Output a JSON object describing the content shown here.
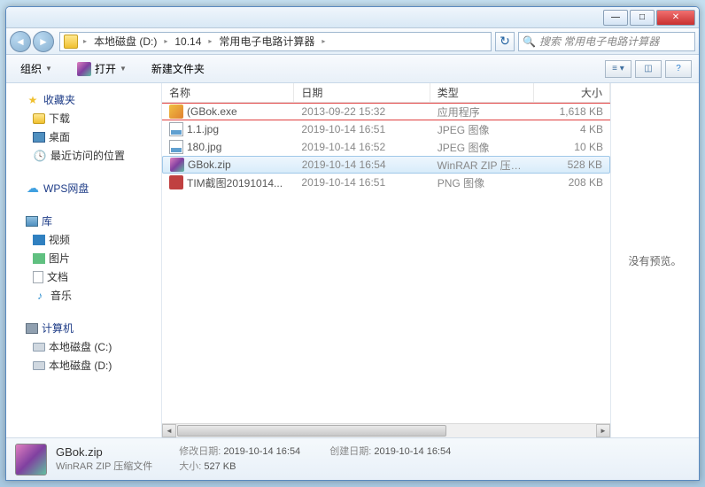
{
  "titlebar": {
    "min": "—",
    "max": "□",
    "close": "✕"
  },
  "breadcrumb": {
    "parts": [
      "本地磁盘 (D:)",
      "10.14",
      "常用电子电路计算器"
    ]
  },
  "search": {
    "placeholder": "搜索 常用电子电路计算器"
  },
  "toolbar": {
    "organize": "组织",
    "open": "打开",
    "newfolder": "新建文件夹"
  },
  "sidebar": {
    "favorites": {
      "label": "收藏夹",
      "items": [
        {
          "icon": "folder",
          "label": "下载"
        },
        {
          "icon": "desktop",
          "label": "桌面"
        },
        {
          "icon": "recent",
          "label": "最近访问的位置"
        }
      ]
    },
    "wps": {
      "label": "WPS网盘"
    },
    "libraries": {
      "label": "库",
      "items": [
        {
          "icon": "video",
          "label": "视频"
        },
        {
          "icon": "img",
          "label": "图片"
        },
        {
          "icon": "doc",
          "label": "文档"
        },
        {
          "icon": "music",
          "label": "音乐"
        }
      ]
    },
    "computer": {
      "label": "计算机",
      "items": [
        {
          "icon": "disk",
          "label": "本地磁盘 (C:)"
        },
        {
          "icon": "disk",
          "label": "本地磁盘 (D:)"
        }
      ]
    }
  },
  "columns": {
    "name": "名称",
    "date": "日期",
    "type": "类型",
    "size": "大小"
  },
  "files": [
    {
      "name": "(GBok.exe",
      "date": "2013-09-22 15:32",
      "type": "应用程序",
      "size": "1,618 KB",
      "ico": "exe",
      "highlighted": true
    },
    {
      "name": "1.1.jpg",
      "date": "2019-10-14 16:51",
      "type": "JPEG 图像",
      "size": "4 KB",
      "ico": "jpg"
    },
    {
      "name": "180.jpg",
      "date": "2019-10-14 16:52",
      "type": "JPEG 图像",
      "size": "10 KB",
      "ico": "jpg"
    },
    {
      "name": "GBok.zip",
      "date": "2019-10-14 16:54",
      "type": "WinRAR ZIP 压缩...",
      "size": "528 KB",
      "ico": "zip",
      "selected": true
    },
    {
      "name": "TIM截图20191014...",
      "date": "2019-10-14 16:51",
      "type": "PNG 图像",
      "size": "208 KB",
      "ico": "png"
    }
  ],
  "preview": {
    "text": "没有预览。"
  },
  "statusbar": {
    "title": "GBok.zip",
    "subtitle": "WinRAR ZIP 压缩文件",
    "modified_label": "修改日期:",
    "modified_value": "2019-10-14 16:54",
    "created_label": "创建日期:",
    "created_value": "2019-10-14 16:54",
    "size_label": "大小:",
    "size_value": "527 KB"
  }
}
